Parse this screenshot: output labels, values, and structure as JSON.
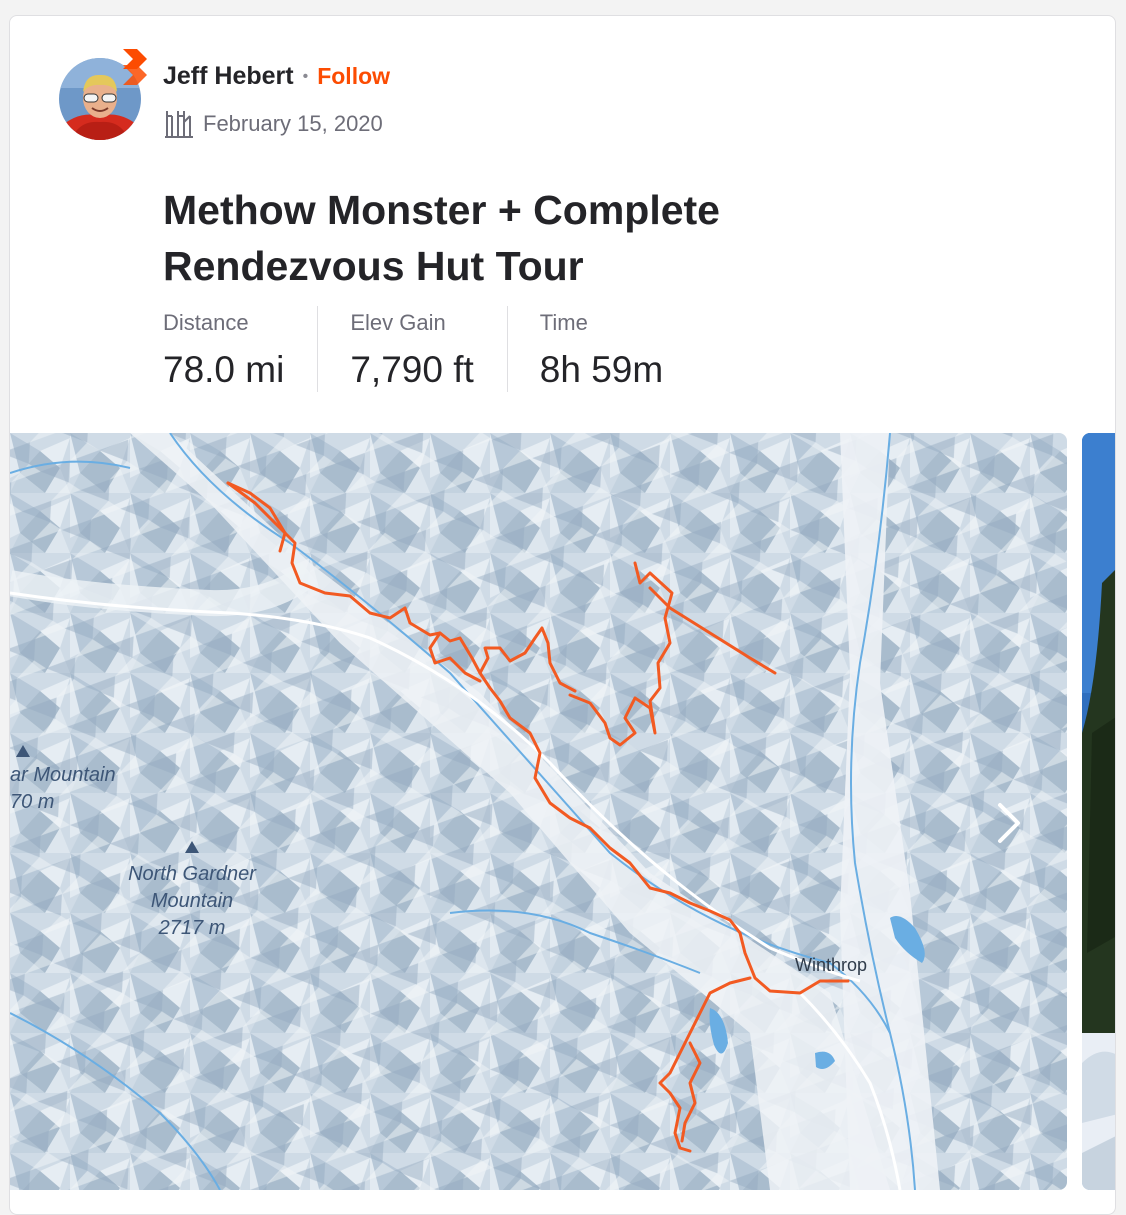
{
  "athlete": {
    "name": "Jeff Hebert",
    "follow_label": "Follow",
    "separator": "•"
  },
  "activity": {
    "date": "February 15, 2020",
    "sport_icon": "nordic-ski-icon",
    "title": "Methow Monster + Complete Rendezvous Hut Tour"
  },
  "stats": [
    {
      "label": "Distance",
      "value": "78.0 mi"
    },
    {
      "label": "Elev Gain",
      "value": "7,790 ft"
    },
    {
      "label": "Time",
      "value": "8h 59m"
    }
  ],
  "map": {
    "labels": {
      "cut_peak_name": "ar Mountain",
      "cut_peak_elev": "70 m",
      "north_gardner_name_1": "North Gardner",
      "north_gardner_name_2": "Mountain",
      "north_gardner_elev": "2717 m",
      "town": "Winthrop"
    },
    "route_color": "#f25a22",
    "next_icon": "chevron-right-icon"
  },
  "colors": {
    "accent": "#fc4c02",
    "text_primary": "#242428",
    "text_secondary": "#6d6d78"
  }
}
